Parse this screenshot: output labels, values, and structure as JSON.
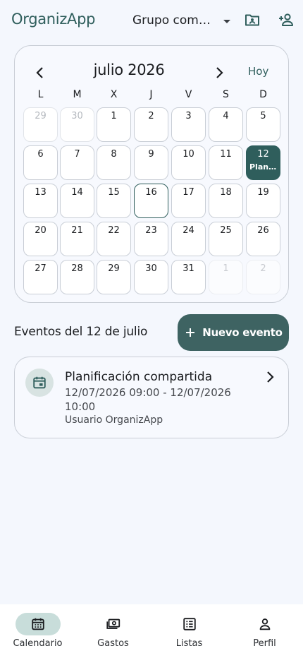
{
  "app": {
    "title": "OrganizApp"
  },
  "header": {
    "group_label": "Grupo compartido",
    "icons": [
      "chevron-down-icon",
      "folder-user-icon",
      "add-person-icon"
    ]
  },
  "calendar": {
    "month_label": "julio 2026",
    "today_label": "Hoy",
    "weekdays": [
      "L",
      "M",
      "X",
      "J",
      "V",
      "S",
      "D"
    ],
    "days": [
      {
        "n": "29",
        "state": "other"
      },
      {
        "n": "30",
        "state": "other"
      },
      {
        "n": "1"
      },
      {
        "n": "2"
      },
      {
        "n": "3"
      },
      {
        "n": "4"
      },
      {
        "n": "5"
      },
      {
        "n": "6"
      },
      {
        "n": "7"
      },
      {
        "n": "8"
      },
      {
        "n": "9"
      },
      {
        "n": "10"
      },
      {
        "n": "11"
      },
      {
        "n": "12",
        "state": "selected",
        "event": "Planificación compartida"
      },
      {
        "n": "13"
      },
      {
        "n": "14"
      },
      {
        "n": "15"
      },
      {
        "n": "16",
        "state": "today"
      },
      {
        "n": "17"
      },
      {
        "n": "18"
      },
      {
        "n": "19"
      },
      {
        "n": "20"
      },
      {
        "n": "21"
      },
      {
        "n": "22"
      },
      {
        "n": "23"
      },
      {
        "n": "24"
      },
      {
        "n": "25"
      },
      {
        "n": "26"
      },
      {
        "n": "27"
      },
      {
        "n": "28"
      },
      {
        "n": "29"
      },
      {
        "n": "30"
      },
      {
        "n": "31"
      },
      {
        "n": "1",
        "state": "faded"
      },
      {
        "n": "2",
        "state": "faded"
      }
    ]
  },
  "events": {
    "section_title": "Eventos del 12 de julio",
    "new_event_label": "Nuevo evento",
    "items": [
      {
        "title": "Planificación compartida",
        "dates": "12/07/2026 09:00 - 12/07/2026 10:00",
        "owner": "Usuario OrganizApp",
        "icon": "calendar-event-icon"
      }
    ]
  },
  "bottom_nav": {
    "items": [
      {
        "label": "Calendario",
        "icon": "calendar-icon",
        "active": true
      },
      {
        "label": "Gastos",
        "icon": "money-icon",
        "active": false
      },
      {
        "label": "Listas",
        "icon": "list-icon",
        "active": false
      },
      {
        "label": "Perfil",
        "icon": "person-icon",
        "active": false
      }
    ]
  },
  "colors": {
    "accent": "#2f5e5c",
    "button": "#3e6362",
    "background": "#f4f7fd",
    "active_pill": "#c8ddda"
  }
}
